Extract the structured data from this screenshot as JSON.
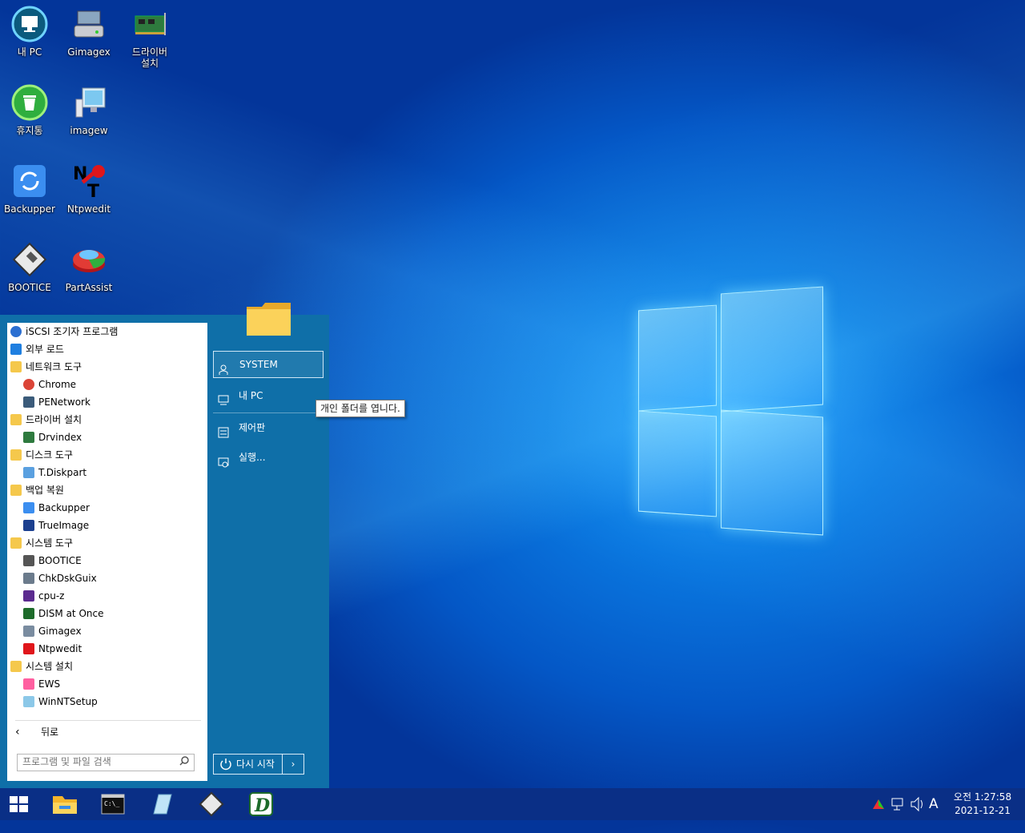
{
  "desktop": {
    "icons": [
      {
        "label": "내 PC",
        "icon": "my-pc-icon"
      },
      {
        "label": "Gimagex",
        "icon": "gimagex-icon"
      },
      {
        "label": "드라이버\n설치",
        "icon": "driver-install-icon"
      },
      {
        "label": "휴지통",
        "icon": "recycle-bin-icon"
      },
      {
        "label": "imagew",
        "icon": "imagew-icon"
      },
      {
        "label": "Backupper",
        "icon": "backupper-icon"
      },
      {
        "label": "Ntpwedit",
        "icon": "ntpwedit-icon"
      },
      {
        "label": "BOOTICE",
        "icon": "bootice-icon"
      },
      {
        "label": "PartAssist",
        "icon": "partassist-icon"
      }
    ]
  },
  "start_menu": {
    "program_tree": [
      {
        "label": "iSCSI 조기자 프로그램",
        "level": 0,
        "icon": "globe-icon"
      },
      {
        "label": "외부 로드",
        "level": 0,
        "icon": "refresh-icon"
      },
      {
        "label": "네트워크 도구",
        "level": 0,
        "icon": "folder-icon"
      },
      {
        "label": "Chrome",
        "level": 1,
        "icon": "chrome-icon"
      },
      {
        "label": "PENetwork",
        "level": 1,
        "icon": "network-icon"
      },
      {
        "label": "드라이버 설치",
        "level": 0,
        "icon": "folder-icon"
      },
      {
        "label": "Drvindex",
        "level": 1,
        "icon": "driver-icon"
      },
      {
        "label": "디스크 도구",
        "level": 0,
        "icon": "folder-icon"
      },
      {
        "label": "T.Diskpart",
        "level": 1,
        "icon": "diskpart-icon"
      },
      {
        "label": "백업 복원",
        "level": 0,
        "icon": "folder-icon"
      },
      {
        "label": "Backupper",
        "level": 1,
        "icon": "backupper-icon"
      },
      {
        "label": "TrueImage",
        "level": 1,
        "icon": "trueimage-icon"
      },
      {
        "label": "시스템 도구",
        "level": 0,
        "icon": "folder-icon"
      },
      {
        "label": "BOOTICE",
        "level": 1,
        "icon": "bootice-icon"
      },
      {
        "label": "ChkDskGuix",
        "level": 1,
        "icon": "chkdsk-icon"
      },
      {
        "label": "cpu-z",
        "level": 1,
        "icon": "cpu-z-icon"
      },
      {
        "label": "DISM at Once",
        "level": 1,
        "icon": "dism-icon"
      },
      {
        "label": "Gimagex",
        "level": 1,
        "icon": "gimagex-icon"
      },
      {
        "label": "Ntpwedit",
        "level": 1,
        "icon": "ntpwedit-icon"
      },
      {
        "label": "시스템 설치",
        "level": 0,
        "icon": "folder-icon"
      },
      {
        "label": "EWS",
        "level": 1,
        "icon": "ews-icon"
      },
      {
        "label": "WinNTSetup",
        "level": 1,
        "icon": "winntsetup-icon"
      }
    ],
    "back_label": "뒤로",
    "search_placeholder": "프로그램 및 파일 검색",
    "right_items": [
      {
        "label": "SYSTEM",
        "icon": "user-icon",
        "selected": true
      },
      {
        "label": "내 PC",
        "icon": "computer-icon",
        "selected": false
      },
      {
        "label": "제어판",
        "icon": "control-panel-icon",
        "selected": false
      },
      {
        "label": "실행...",
        "icon": "run-icon",
        "selected": false
      }
    ],
    "restart_label": "다시 시작",
    "restart_arrow": "›"
  },
  "tooltip": {
    "text": "개인 폴더를 엽니다."
  },
  "taskbar": {
    "pinned": [
      "start-icon",
      "file-explorer-icon",
      "cmd-icon",
      "imagew-icon",
      "bootice-icon",
      "dism-icon"
    ],
    "tray": {
      "ime": "A"
    },
    "clock": {
      "time": "오전 1:27:58",
      "date": "2021-12-21"
    }
  },
  "colors": {
    "start_menu_bg": "#0f6fa8",
    "taskbar_bg": "#0a2f86"
  }
}
